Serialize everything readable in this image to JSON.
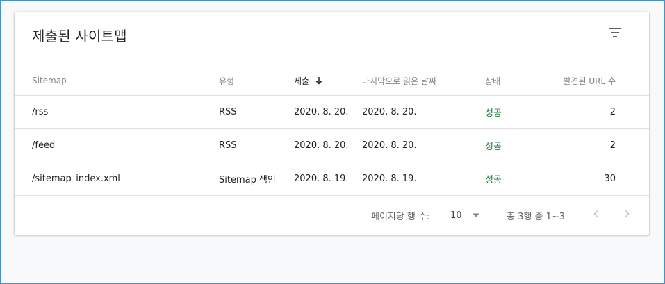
{
  "card": {
    "title": "제출된 사이트맵",
    "filter_icon": "filter-list-icon"
  },
  "table": {
    "columns": [
      "Sitemap",
      "유형",
      "제출",
      "마지막으로 읽은 날짜",
      "상태",
      "발견된 URL 수"
    ],
    "sorted_column": "제출",
    "sort_direction": "descending",
    "rows": [
      {
        "sitemap": "/rss",
        "type": "RSS",
        "submitted": "2020. 8. 20.",
        "last_read": "2020. 8. 20.",
        "status": "성공",
        "urls": "2"
      },
      {
        "sitemap": "/feed",
        "type": "RSS",
        "submitted": "2020. 8. 20.",
        "last_read": "2020. 8. 20.",
        "status": "성공",
        "urls": "2"
      },
      {
        "sitemap": "/sitemap_index.xml",
        "type": "Sitemap 색인",
        "submitted": "2020. 8. 19.",
        "last_read": "2020. 8. 19.",
        "status": "성공",
        "urls": "30"
      }
    ]
  },
  "pagination": {
    "rows_per_page_label": "페이지당 행 수:",
    "rows_per_page_value": "10",
    "range_text": "총 3행 중 1~3",
    "prev_icon": "chevron-left-icon",
    "next_icon": "chevron-right-icon"
  },
  "colors": {
    "status_success": "#188038",
    "header_text": "#80868b",
    "border": "#e0e0e0",
    "page_background": "#f8f9fa"
  }
}
